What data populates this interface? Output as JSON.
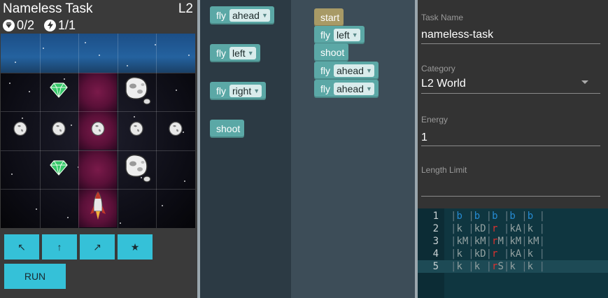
{
  "task": {
    "title": "Nameless Task",
    "level": "L2"
  },
  "stats": {
    "gems": "0/2",
    "energy": "1/1"
  },
  "controls": {
    "left_label": "↖",
    "ahead_label": "↑",
    "right_label": "↗",
    "shoot_label": "★",
    "run_label": "RUN"
  },
  "board": {
    "rows": [
      [
        "b",
        "b",
        "b",
        "b",
        "b"
      ],
      [
        "k",
        "kD",
        "r",
        "kA",
        "k"
      ],
      [
        "kM",
        "kM",
        "rM",
        "kM",
        "kM"
      ],
      [
        "k",
        "kD",
        "r",
        "kA",
        "k"
      ],
      [
        "k",
        "k",
        "rS",
        "k",
        "k"
      ]
    ]
  },
  "toolbox": {
    "blocks": [
      {
        "label": "fly",
        "option": "ahead"
      },
      {
        "label": "fly",
        "option": "left"
      },
      {
        "label": "fly",
        "option": "right"
      },
      {
        "label": "shoot",
        "option": ""
      }
    ]
  },
  "program": {
    "start_label": "start",
    "blocks": [
      {
        "label": "fly",
        "option": "left"
      },
      {
        "label": "shoot",
        "option": ""
      },
      {
        "label": "fly",
        "option": "ahead"
      },
      {
        "label": "fly",
        "option": "ahead"
      }
    ]
  },
  "form": {
    "task_name_label": "Task Name",
    "task_name_value": "nameless-task",
    "category_label": "Category",
    "category_value": "L2 World",
    "energy_label": "Energy",
    "energy_value": "1",
    "length_label": "Length Limit",
    "length_value": ""
  },
  "code": {
    "lines": [
      {
        "num": "1"
      },
      {
        "num": "2"
      },
      {
        "num": "3"
      },
      {
        "num": "4"
      },
      {
        "num": "5"
      }
    ],
    "active_line": 5
  },
  "colors": {
    "button": "#35c1d8",
    "block": "#5ba8a6",
    "start_block": "#a89a66",
    "editor_bg": "#0f3640"
  },
  "icons": {
    "gem": "diamond-icon",
    "energy": "lightning-icon",
    "asteroid": "asteroid-icon",
    "meteor": "meteor-icon",
    "ship": "spaceship-icon"
  }
}
